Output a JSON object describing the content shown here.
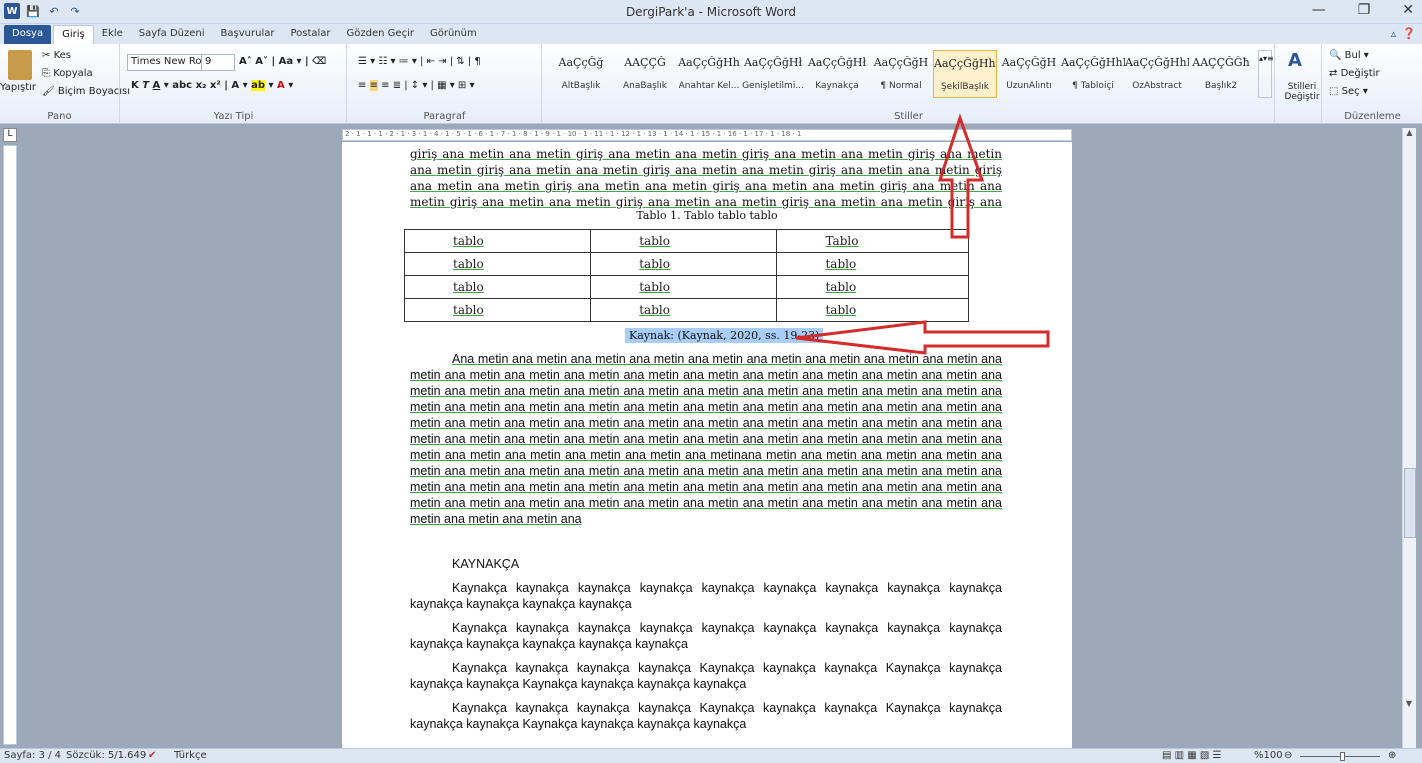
{
  "title": "DergiPark'a - Microsoft Word",
  "qat": {
    "logo": "W",
    "save": "💾",
    "undo": "↶",
    "redo": "↷"
  },
  "window": {
    "minimize": "—",
    "restore": "❐",
    "close": "✕"
  },
  "tabs": [
    "Dosya",
    "Giriş",
    "Ekle",
    "Sayfa Düzeni",
    "Başvurular",
    "Postalar",
    "Gözden Geçir",
    "Görünüm"
  ],
  "ribbon": {
    "clipboard": {
      "paste": "Yapıştır",
      "cut": "Kes",
      "copy": "Kopyala",
      "format_painter": "Biçim Boyacısı",
      "label": "Pano"
    },
    "font": {
      "family": "Times New Ro",
      "size": "9",
      "label": "Yazı Tipi"
    },
    "paragraph": {
      "label": "Paragraf"
    },
    "styles": {
      "label": "Stiller",
      "items": [
        {
          "preview": "AaÇçĞğ",
          "name": "AltBaşlık"
        },
        {
          "preview": "AAÇÇĞ",
          "name": "AnaBaşlık"
        },
        {
          "preview": "AaÇçĞğHh",
          "name": "Anahtar Kel..."
        },
        {
          "preview": "AaÇçĞğHł",
          "name": "Genişletilmi..."
        },
        {
          "preview": "AaÇçĞğHł",
          "name": "Kaynakça"
        },
        {
          "preview": "AaÇçĞğH",
          "name": "¶ Normal"
        },
        {
          "preview": "AaÇçĞğHhI",
          "name": "ŞekilBaşlık"
        },
        {
          "preview": "AaÇçĞğH",
          "name": "UzunAlıntı"
        },
        {
          "preview": "AaÇçĞğHhI",
          "name": "¶ Tabloiçi"
        },
        {
          "preview": "AaÇçĞğHhI",
          "name": "ÖzAbstract"
        },
        {
          "preview": "AAÇÇĞĞħ",
          "name": "Başlık2"
        }
      ],
      "change_styles": "Stilleri Değiştir"
    },
    "editing": {
      "find": "Bul",
      "replace": "Değiştir",
      "select": "Seç",
      "label": "Düzenleme"
    }
  },
  "ruler": "2 · 1 · 1 · 1 · 2 · 1 · 3 · 1 · 4 · 1 · 5 · 1 · 6 · 1 · 7 · 1 · 8 · 1 · 9 · 1 · 10 · 1 · 11 · 1 · 12 · 1 · 13 · 1 · 14 · 1 · 15 · 1 · 16 · 1 · 17 · 1 · 18 · 1",
  "document": {
    "intro": "giriş ana metin ana metin giriş ana metin ana metin giriş ana metin ana metin giriş ana metin ana metin giriş ana metin ana metin giriş ana metin ana metin giriş ana metin ana metin giriş ana metin ana metin giriş ana metin ana metin giriş ana metin ana metin giriş ana metin ana metin giriş ana metin ana metin giriş ana metin ana metin giriş ana metin ana metin giriş ana metinana metin giriş ana metin ana.",
    "table_caption": "Tablo 1. Tablo tablo tablo",
    "table": [
      [
        "tablo",
        "tablo",
        "Tablo"
      ],
      [
        "tablo",
        "tablo",
        "tablo"
      ],
      [
        "tablo",
        "tablo",
        "tablo"
      ],
      [
        "tablo",
        "tablo",
        "tablo"
      ]
    ],
    "source": "Kaynak: (Kaynak, 2020, ss. 19-23)",
    "body": "Ana metin ana metin ana metin ana metin ana metin ana metin ana metin ana metin ana metin ana metin ana metin ana metin ana metin ana metin ana metin ana metin ana metin ana metin ana metin ana metin ana metin ana metin ana metin ana metin ana metin ana metin ana metin ana metin ana metin ana metin ana metin ana metin ana metin ana metin ana metin ana metin ana metin ana metin ana metin ana metin ana metin ana metin ana metin ana metin ana metin ana metin ana metin ana metin ana metin ana metin ana metin ana metin ana metin ana metin ana metin ana metin ana metin ana metin ana metin ana metin ana metin ana metin ana metin ana metin ana metinana metin ana metin ana metin ana metin ana metin ana metin ana metin ana metin ana metin ana metin ana metin ana metin ana metin ana metin ana metin ana metin ana metin ana metin ana metin ana metin ana metin ana metin ana metin ana metin ana metin ana metin ana metin ana metin ana metin ana metin ana metin ana metin ana metin ana metin ana metin ana metin ana metin ana",
    "heading": "KAYNAKÇA",
    "refs": [
      "Kaynakça kaynakça kaynakça kaynakça kaynakça kaynakça kaynakça kaynakça kaynakça kaynakça kaynakça kaynakça kaynakça",
      "Kaynakça kaynakça kaynakça kaynakça kaynakça kaynakça kaynakça kaynakça kaynakça kaynakça kaynakça kaynakça kaynakça kaynakça",
      "Kaynakça kaynakça kaynakça kaynakça Kaynakça kaynakça kaynakça Kaynakça kaynakça kaynakça kaynakça Kaynakça kaynakça kaynakça kaynakça",
      "Kaynakça kaynakça kaynakça kaynakça Kaynakça kaynakça kaynakça Kaynakça kaynakça kaynakça kaynakça Kaynakça kaynakça kaynakça kaynakça"
    ]
  },
  "status": {
    "page": "Sayfa: 3 / 4",
    "words": "Sözcük: 5/1.649",
    "language": "Türkçe",
    "zoom": "%100"
  },
  "colors": {
    "accent": "#2b5797",
    "annotation": "#d42b2b",
    "selection": "#a9cef5"
  }
}
